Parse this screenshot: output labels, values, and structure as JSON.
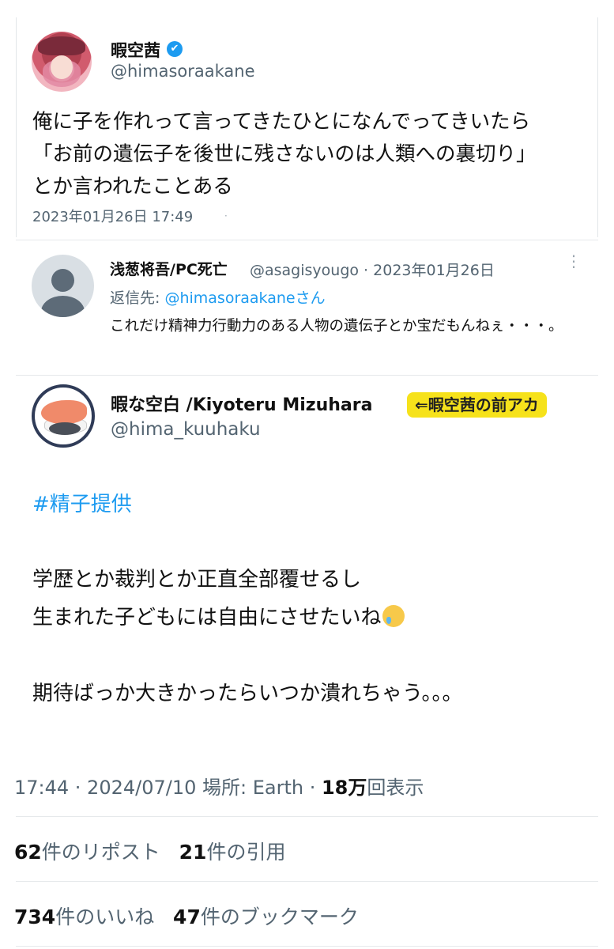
{
  "quoted_tweet": {
    "author_name": "暇空茜",
    "verified_mark": "✔",
    "author_handle": "@himasoraakane",
    "text_lines": [
      "俺に子を作れって言ってきたひとになんでってきいたら",
      "「お前の遺伝子を後世に残さないのは人類への裏切り」",
      "とか言われたことある"
    ],
    "timestamp": "2023年01月26日 17:49",
    "timestamp_mark": "·"
  },
  "reply": {
    "author_name": "浅葱将吾/PC死亡",
    "meta": "@asagisyougo · 2023年01月26日",
    "reply_prefix": "返信先: ",
    "reply_target": "@himasoraakaneさん",
    "text": "これだけ精神力行動力のある人物の遺伝子とか宝だもんねぇ・・・。",
    "more_label": "⋮"
  },
  "main_tweet": {
    "author_name": "暇な空白 /Kiyoteru Mizuhara",
    "annotation": "⇐暇空茜の前アカ",
    "author_handle": "@hima_kuuhaku",
    "hashtag": "#精子提供",
    "lines": [
      "学歴とか裁判とか正直全部覆せるし",
      "生まれた子どもには自由にさせたいね",
      "期待ばっか大きかったらいつか潰れちゃう。。。"
    ],
    "emoji": "crying-face"
  },
  "footer": {
    "time": "17:44 · 2024/07/10 場所: Earth · ",
    "views_count": "18万",
    "views_label": "回表示",
    "reposts_count": "62",
    "reposts_label": "件のリポスト",
    "quotes_count": "21",
    "quotes_label": "件の引用",
    "likes_count": "734",
    "likes_label": "件のいいね",
    "bookmarks_count": "47",
    "bookmarks_label": "件のブックマーク"
  },
  "colors": {
    "link": "#1d9bf0",
    "secondary_text": "#536471",
    "annotation_bg": "#f6e21b"
  }
}
